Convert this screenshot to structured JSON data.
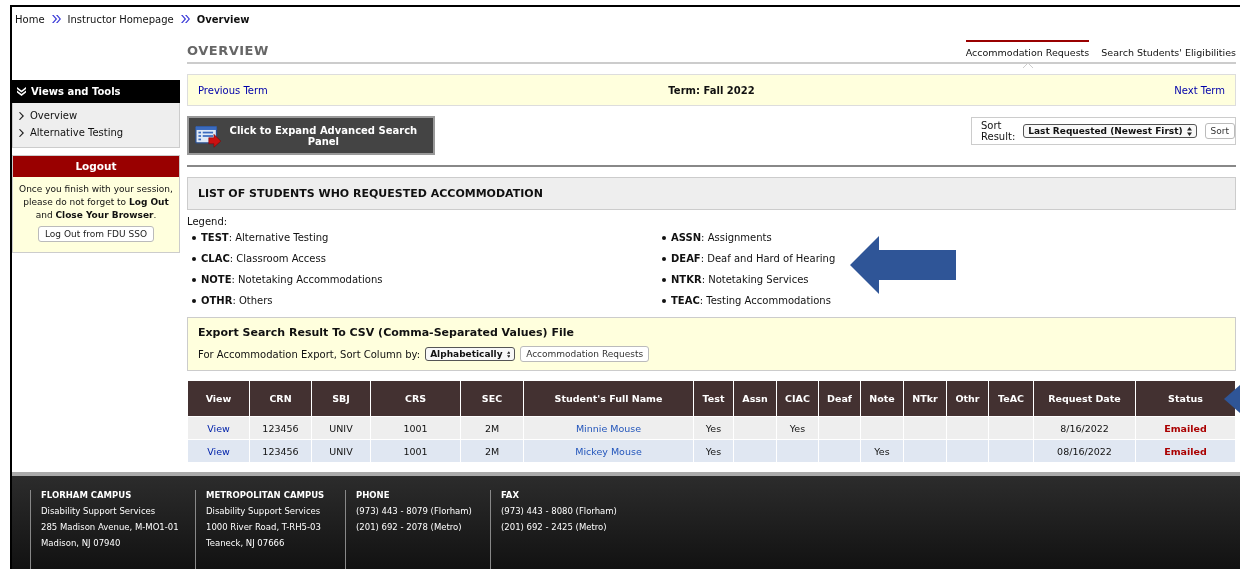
{
  "breadcrumb": [
    "Home",
    "Instructor Homepage",
    "Overview"
  ],
  "sidebar": {
    "title": "Views and Tools",
    "items": [
      "Overview",
      "Alternative Testing"
    ]
  },
  "logout": {
    "title": "Logout",
    "message": "Once you finish with your session, please do not forget to **Log Out** and **Close Your Browser**.",
    "button": "Log Out from FDU SSO"
  },
  "page_title": "OVERVIEW",
  "tabs": [
    {
      "label": "Accommodation Requests",
      "selected": true
    },
    {
      "label": "Search Students' Eligibilities",
      "selected": false
    }
  ],
  "term_bar": {
    "previous": "Previous Term",
    "term": "Term: Fall 2022",
    "next": "Next Term"
  },
  "search_panel_button": "Click to Expand Advanced Search Panel",
  "sort": {
    "label": "Sort Result:",
    "value": "Last Requested (Newest First)",
    "button": "Sort"
  },
  "list_title": "LIST OF STUDENTS WHO REQUESTED ACCOMMODATION",
  "legend": {
    "label": "Legend:",
    "items": [
      "**TEST**: Alternative Testing",
      "**CLAC**: Classroom Access",
      "**NOTE**: Notetaking Accommodations",
      "**OTHR**: Others",
      "**ASSN**: Assignments",
      "**DEAF**: Deaf and Hard of Hearing",
      "**NTKR**: Notetaking Services",
      "**TEAC**: Testing Accommodations"
    ]
  },
  "export": {
    "title": "Export Search Result To CSV (Comma-Separated Values) File",
    "sort_label": "For Accommodation Export, Sort Column by:",
    "sort_value": "Alphabetically",
    "button": "Accommodation Requests"
  },
  "table": {
    "columns": [
      {
        "label": "View",
        "kind": "link"
      },
      {
        "label": "CRN",
        "kind": "text"
      },
      {
        "label": "SBJ",
        "kind": "text"
      },
      {
        "label": "CRS",
        "kind": "text"
      },
      {
        "label": "SEC",
        "kind": "text"
      },
      {
        "label": "Student's Full Name",
        "kind": "link"
      },
      {
        "label": "Test",
        "kind": "text"
      },
      {
        "label": "Assn",
        "kind": "text"
      },
      {
        "label": "CIAC",
        "kind": "text"
      },
      {
        "label": "Deaf",
        "kind": "text"
      },
      {
        "label": "Note",
        "kind": "text"
      },
      {
        "label": "NTkr",
        "kind": "text"
      },
      {
        "label": "Othr",
        "kind": "text"
      },
      {
        "label": "TeAC",
        "kind": "text"
      },
      {
        "label": "Request Date",
        "kind": "text"
      },
      {
        "label": "Status",
        "kind": "status"
      }
    ],
    "rows": [
      [
        "View",
        "123456",
        "UNIV",
        "1001",
        "2M",
        "Minnie Mouse",
        "Yes",
        "",
        "Yes",
        "",
        "",
        "",
        "",
        "",
        "8/16/2022",
        "Emailed"
      ],
      [
        "View",
        "123456",
        "UNIV",
        "1001",
        "2M",
        "Mickey Mouse",
        "Yes",
        "",
        "",
        "",
        "Yes",
        "",
        "",
        "",
        "08/16/2022",
        "Emailed"
      ]
    ]
  },
  "footer": [
    {
      "title": "FLORHAM CAMPUS",
      "lines": [
        "Disability Support Services",
        "285 Madison Avenue, M-MO1-01",
        "Madison, NJ 07940"
      ]
    },
    {
      "title": "METROPOLITAN CAMPUS",
      "lines": [
        "Disability Support Services",
        "1000 River Road, T-RH5-03",
        "Teaneck, NJ 07666"
      ]
    },
    {
      "title": "PHONE",
      "lines": [
        "(973) 443 - 8079 (Florham)",
        "(201) 692 - 2078 (Metro)"
      ]
    },
    {
      "title": "FAX",
      "lines": [
        "(973) 443 - 8080 (Florham)",
        "(201) 692 - 2425 (Metro)"
      ]
    }
  ]
}
